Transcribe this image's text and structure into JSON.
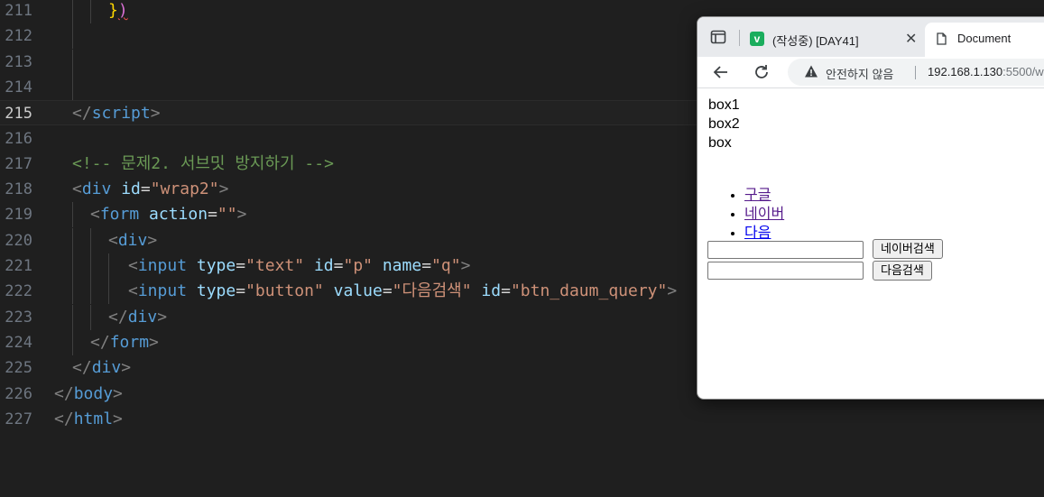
{
  "editor": {
    "lines": [
      {
        "n": "211",
        "tokens": [
          {
            "t": "}",
            "c": "c-brace"
          },
          {
            "t": ")",
            "c": "c-paren"
          }
        ],
        "indent": 120,
        "guides": [
          80,
          100
        ]
      },
      {
        "n": "212",
        "tokens": [],
        "indent": 60,
        "guides": [
          80
        ]
      },
      {
        "n": "213",
        "tokens": [],
        "indent": 60,
        "guides": [
          80
        ]
      },
      {
        "n": "214",
        "tokens": [],
        "indent": 60,
        "guides": [
          80
        ]
      },
      {
        "n": "215",
        "tokens": [
          {
            "t": "</",
            "c": "c-punc"
          },
          {
            "t": "script",
            "c": "c-tag"
          },
          {
            "t": ">",
            "c": "c-punc"
          }
        ],
        "indent": 80,
        "guides": [],
        "current": true
      },
      {
        "n": "216",
        "tokens": [],
        "indent": 60,
        "guides": []
      },
      {
        "n": "217",
        "tokens": [
          {
            "t": "<!-- 문제2. 서브밋 방지하기 -->",
            "c": "c-com"
          }
        ],
        "indent": 80,
        "guides": []
      },
      {
        "n": "218",
        "tokens": [
          {
            "t": "<",
            "c": "c-punc"
          },
          {
            "t": "div",
            "c": "c-tag"
          },
          {
            "t": " ",
            "c": "c-text"
          },
          {
            "t": "id",
            "c": "c-attr"
          },
          {
            "t": "=",
            "c": "c-text"
          },
          {
            "t": "\"wrap2\"",
            "c": "c-str"
          },
          {
            "t": ">",
            "c": "c-punc"
          }
        ],
        "indent": 80,
        "guides": []
      },
      {
        "n": "219",
        "tokens": [
          {
            "t": "<",
            "c": "c-punc"
          },
          {
            "t": "form",
            "c": "c-tag"
          },
          {
            "t": " ",
            "c": "c-text"
          },
          {
            "t": "action",
            "c": "c-attr"
          },
          {
            "t": "=",
            "c": "c-text"
          },
          {
            "t": "\"\"",
            "c": "c-str"
          },
          {
            "t": ">",
            "c": "c-punc"
          }
        ],
        "indent": 100,
        "guides": [
          80
        ]
      },
      {
        "n": "220",
        "tokens": [
          {
            "t": "<",
            "c": "c-punc"
          },
          {
            "t": "div",
            "c": "c-tag"
          },
          {
            "t": ">",
            "c": "c-punc"
          }
        ],
        "indent": 120,
        "guides": [
          80,
          100
        ]
      },
      {
        "n": "221",
        "tokens": [
          {
            "t": "<",
            "c": "c-punc"
          },
          {
            "t": "input",
            "c": "c-tag"
          },
          {
            "t": " ",
            "c": "c-text"
          },
          {
            "t": "type",
            "c": "c-attr"
          },
          {
            "t": "=",
            "c": "c-text"
          },
          {
            "t": "\"text\"",
            "c": "c-str"
          },
          {
            "t": " ",
            "c": "c-text"
          },
          {
            "t": "id",
            "c": "c-attr"
          },
          {
            "t": "=",
            "c": "c-text"
          },
          {
            "t": "\"p\"",
            "c": "c-str"
          },
          {
            "t": " ",
            "c": "c-text"
          },
          {
            "t": "name",
            "c": "c-attr"
          },
          {
            "t": "=",
            "c": "c-text"
          },
          {
            "t": "\"q\"",
            "c": "c-str"
          },
          {
            "t": ">",
            "c": "c-punc"
          }
        ],
        "indent": 142,
        "guides": [
          80,
          100,
          120
        ]
      },
      {
        "n": "222",
        "tokens": [
          {
            "t": "<",
            "c": "c-punc"
          },
          {
            "t": "input",
            "c": "c-tag"
          },
          {
            "t": " ",
            "c": "c-text"
          },
          {
            "t": "type",
            "c": "c-attr"
          },
          {
            "t": "=",
            "c": "c-text"
          },
          {
            "t": "\"button\"",
            "c": "c-str"
          },
          {
            "t": " ",
            "c": "c-text"
          },
          {
            "t": "value",
            "c": "c-attr"
          },
          {
            "t": "=",
            "c": "c-text"
          },
          {
            "t": "\"다음검색\"",
            "c": "c-str"
          },
          {
            "t": " ",
            "c": "c-text"
          },
          {
            "t": "id",
            "c": "c-attr"
          },
          {
            "t": "=",
            "c": "c-text"
          },
          {
            "t": "\"btn_daum_query\"",
            "c": "c-str"
          },
          {
            "t": ">",
            "c": "c-punc"
          }
        ],
        "indent": 142,
        "guides": [
          80,
          100,
          120
        ]
      },
      {
        "n": "223",
        "tokens": [
          {
            "t": "</",
            "c": "c-punc"
          },
          {
            "t": "div",
            "c": "c-tag"
          },
          {
            "t": ">",
            "c": "c-punc"
          }
        ],
        "indent": 120,
        "guides": [
          80,
          100
        ]
      },
      {
        "n": "224",
        "tokens": [
          {
            "t": "</",
            "c": "c-punc"
          },
          {
            "t": "form",
            "c": "c-tag"
          },
          {
            "t": ">",
            "c": "c-punc"
          }
        ],
        "indent": 100,
        "guides": [
          80
        ]
      },
      {
        "n": "225",
        "tokens": [
          {
            "t": "</",
            "c": "c-punc"
          },
          {
            "t": "div",
            "c": "c-tag"
          },
          {
            "t": ">",
            "c": "c-punc"
          }
        ],
        "indent": 80,
        "guides": []
      },
      {
        "n": "226",
        "tokens": [
          {
            "t": "</",
            "c": "c-punc"
          },
          {
            "t": "body",
            "c": "c-tag"
          },
          {
            "t": ">",
            "c": "c-punc"
          }
        ],
        "indent": 60,
        "guides": []
      },
      {
        "n": "227",
        "tokens": [
          {
            "t": "</",
            "c": "c-punc"
          },
          {
            "t": "html",
            "c": "c-tag"
          },
          {
            "t": ">",
            "c": "c-punc"
          }
        ],
        "indent": 60,
        "guides": []
      }
    ]
  },
  "browser": {
    "tabs": [
      {
        "favicon": "v",
        "title": "(작성중) [DAY41]"
      },
      {
        "title": "Document"
      }
    ],
    "omnibox": {
      "security_text": "안전하지 않음",
      "url_host": "192.168.1.130",
      "url_rest": ":5500/w"
    },
    "page": {
      "boxes": [
        "box1",
        "box2",
        "box"
      ],
      "links": [
        "구글",
        "네이버",
        "다음"
      ],
      "buttons": [
        "네이버검색",
        "다음검색"
      ]
    }
  },
  "colors": {
    "editor_bg": "#1f1f1f",
    "tag": "#569cd6",
    "attribute": "#9cdcfe",
    "string": "#ce9178",
    "comment": "#6a9955"
  },
  "icons": [
    "tab-search-icon",
    "favicon-v-icon",
    "close-icon",
    "document-icon",
    "back-arrow-icon",
    "reload-icon",
    "warning-icon"
  ]
}
